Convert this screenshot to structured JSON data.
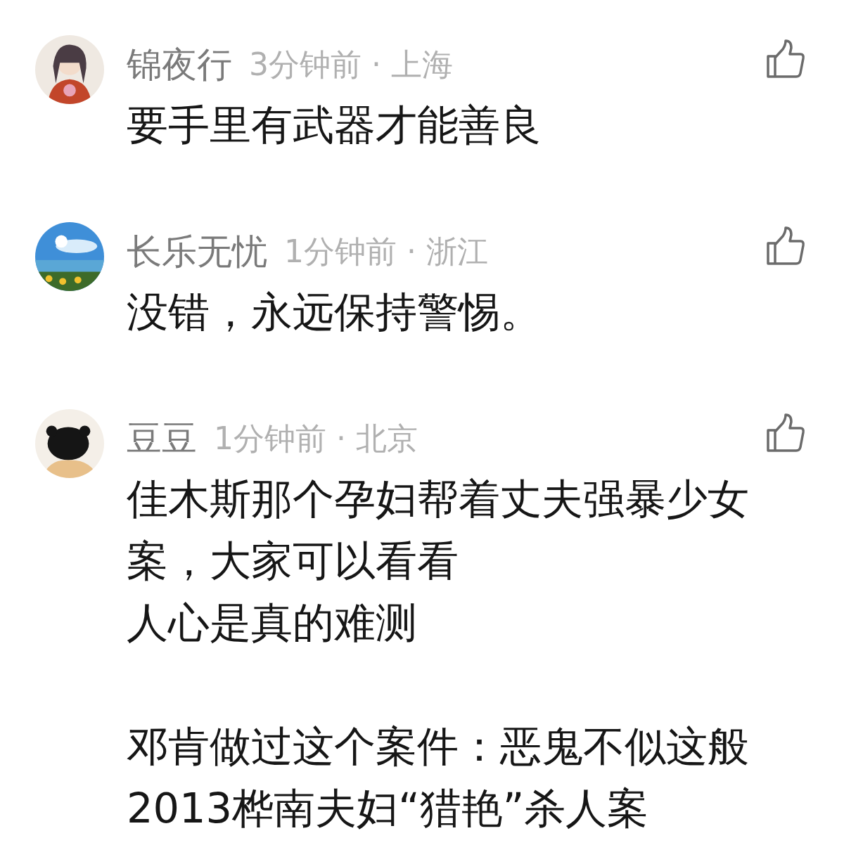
{
  "comments": [
    {
      "avatar": {
        "kind": "picture"
      },
      "user": "锦夜行",
      "time": "3分钟前 · 上海",
      "paragraphs": [
        [
          "要手里有武器才能善良"
        ]
      ]
    },
    {
      "avatar": {
        "kind": "picture"
      },
      "user": "长乐无忧",
      "time": "1分钟前 · 浙江",
      "paragraphs": [
        [
          "没错，永远保持警惕。"
        ]
      ]
    },
    {
      "avatar": {
        "kind": "picture"
      },
      "user": "豆豆",
      "time": "1分钟前 · 北京",
      "paragraphs": [
        [
          "佳木斯那个孕妇帮着丈夫强暴少女案，大家可以看看",
          "人心是真的难测"
        ],
        [
          "邓肯做过这个案件：恶鬼不似这般",
          "2013桦南夫妇“猎艳”杀人案"
        ]
      ]
    }
  ]
}
